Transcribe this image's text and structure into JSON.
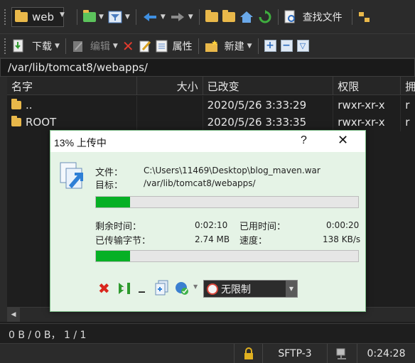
{
  "toolbar1": {
    "location_label": "web",
    "find_files_label": "查找文件"
  },
  "toolbar2": {
    "download_label": "下载",
    "edit_label": "编辑",
    "properties_label": "属性",
    "new_label": "新建"
  },
  "path": "/var/lib/tomcat8/webapps/",
  "columns": {
    "name": "名字",
    "size": "大小",
    "modified": "已改变",
    "permissions": "权限",
    "owner": "拥"
  },
  "rows": [
    {
      "name": "..",
      "size": "",
      "modified": "2020/5/26 3:33:29",
      "permissions": "rwxr-xr-x",
      "owner": "r"
    },
    {
      "name": "ROOT",
      "size": "",
      "modified": "2020/5/26 3:33:35",
      "permissions": "rwxr-xr-x",
      "owner": "r"
    }
  ],
  "dialog": {
    "title": "13% 上传中",
    "help": "?",
    "close": "✕",
    "file_label": "文件：",
    "file_value": "C:\\Users\\11469\\Desktop\\blog_maven.war",
    "target_label": "目标：",
    "target_value": "/var/lib/tomcat8/webapps/",
    "file_progress": 0.13,
    "time_left_label": "剩余时间：",
    "time_left_value": "0:02:10",
    "time_elapsed_label": "已用时间：",
    "time_elapsed_value": "0:00:20",
    "bytes_label": "已传输字节：",
    "bytes_value": "2.74 MB",
    "speed_label": "速度：",
    "speed_value": "138 KB/s",
    "total_progress": 0.13,
    "speed_limit": "无限制",
    "minimize": "_"
  },
  "status": {
    "selection": "0 B / 0 B，  1 / 1",
    "protocol": "SFTP-3",
    "elapsed": "0:24:28"
  },
  "colors": {
    "progress_fill": "#06b025",
    "dialog_bg": "#e5f3e6",
    "app_bg": "#1e1e1e",
    "folder": "#e9b84a",
    "cancel_red": "#d9261c"
  }
}
